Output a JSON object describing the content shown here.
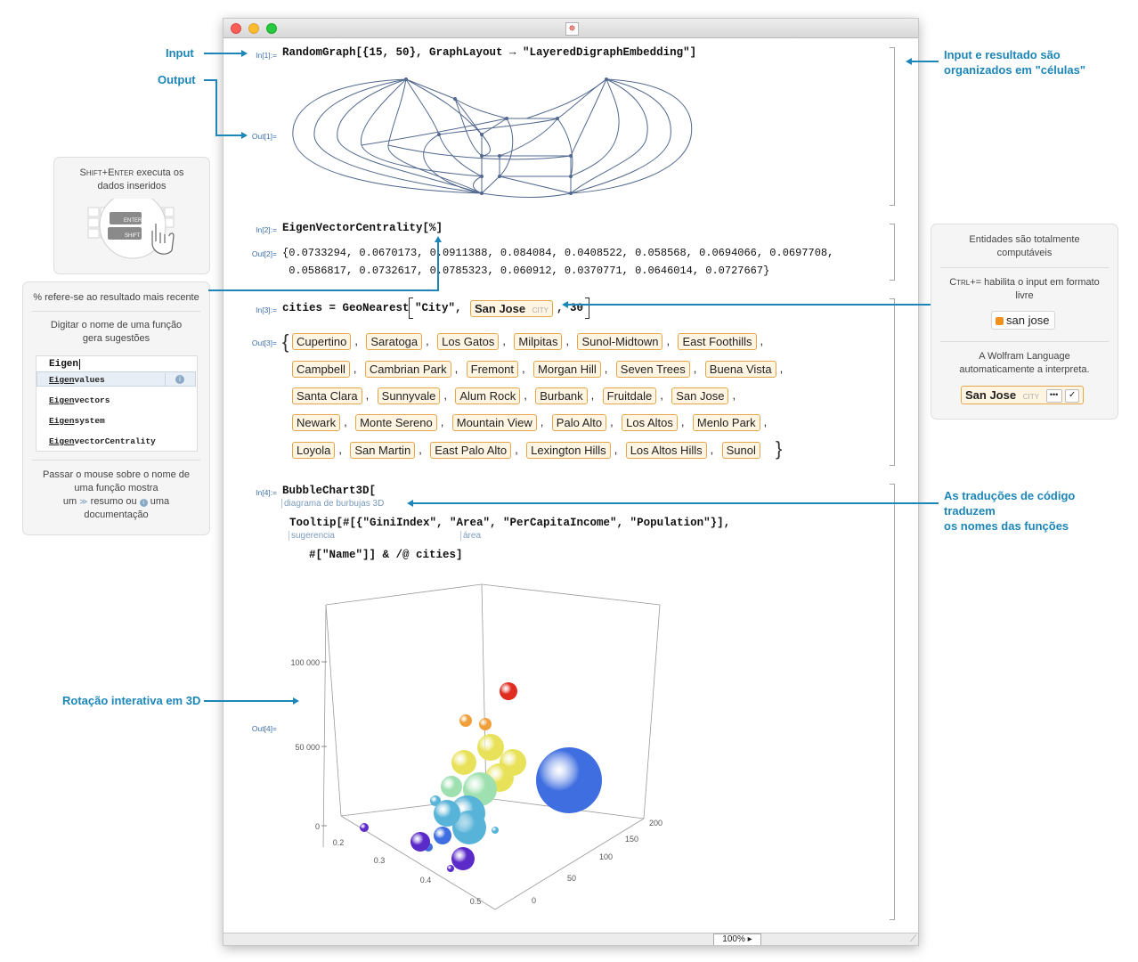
{
  "annotations": {
    "input": "Input",
    "output": "Output",
    "cells_line1": "Input e resultado são",
    "cells_line2": "organizados em \"células\"",
    "translations_line1": "As traduções de código",
    "translations_line2": "traduzem",
    "translations_line3": "os nomes das funções",
    "rotation": "Rotação interativa em 3D"
  },
  "panels": {
    "shift_enter": {
      "text_key": "Shift+Enter",
      "text_rest": " executa os",
      "text_line2": "dados inseridos",
      "key_enter": "ENTER",
      "key_shift": "SHIFT"
    },
    "left": {
      "percent_note": "% refere-se ao resultado mais recente",
      "suggest_line1": "Digitar o nome de uma função",
      "suggest_line2": "gera sugestões",
      "typed": "Eigen",
      "suggestions": [
        "Eigenvalues",
        "Eigenvectors",
        "Eigensystem",
        "EigenvectorCentrality"
      ],
      "hover_line1": "Passar o mouse sobre o nome de",
      "hover_line2": "uma função mostra",
      "hover_line3a": "um",
      "hover_line3b": "resumo ou",
      "hover_line3c": "uma",
      "hover_line4": "documentação"
    },
    "right": {
      "entities_line1": "Entidades são totalmente",
      "entities_line2": "computáveis",
      "ctrl_key": "Ctrl+=",
      "ctrl_rest": " habilita o input em formato",
      "ctrl_line2": "livre",
      "freeform": "san jose",
      "interp_line1": "A Wolfram Language",
      "interp_line2": "automaticamente a interpreta.",
      "entity": "San Jose",
      "entity_type": "CITY"
    }
  },
  "notebook": {
    "zoom": "100%",
    "in1_label": "In[1]:=",
    "in1_code": "RandomGraph[{15, 50}, GraphLayout → \"LayeredDigraphEmbedding\"]",
    "out1_label": "Out[1]=",
    "in2_label": "In[2]:=",
    "in2_code": "EigenVectorCentrality[%]",
    "out2_label": "Out[2]=",
    "out2_line1": "{0.0733294, 0.0670173, 0.0911388, 0.084084, 0.0408522, 0.058568, 0.0694066, 0.0697708,",
    "out2_line2": " 0.0586817, 0.0732617, 0.0785323, 0.060912, 0.0370771, 0.0646014, 0.0727667}",
    "in3_label": "In[3]:=",
    "in3_code_a": "cities = GeoNearest",
    "in3_code_b": "\"City\",",
    "in3_entity": "San Jose",
    "in3_entity_type": "CITY",
    "in3_code_c": ", 30",
    "out3_label": "Out[3]=",
    "cities": [
      [
        "Cupertino",
        "Saratoga",
        "Los Gatos",
        "Milpitas",
        "Sunol-Midtown",
        "East Foothills"
      ],
      [
        "Campbell",
        "Cambrian Park",
        "Fremont",
        "Morgan Hill",
        "Seven Trees",
        "Buena Vista"
      ],
      [
        "Santa Clara",
        "Sunnyvale",
        "Alum Rock",
        "Burbank",
        "Fruitdale",
        "San Jose"
      ],
      [
        "Newark",
        "Monte Sereno",
        "Mountain View",
        "Palo Alto",
        "Los Altos",
        "Menlo Park"
      ],
      [
        "Loyola",
        "San Martin",
        "East Palo Alto",
        "Lexington Hills",
        "Los Altos Hills",
        "Sunol"
      ]
    ],
    "in4_label": "In[4]:=",
    "in4_line1": "BubbleChart3D[",
    "in4_hint1": "diagrama de burbujas 3D",
    "in4_line2": "Tooltip[#[{\"GiniIndex\", \"Area\", \"PerCapitaIncome\", \"Population\"}],",
    "in4_hint2": "sugerencia",
    "in4_hint3": "área",
    "in4_line3": "#[\"Name\"]] & /@ cities]",
    "out4_label": "Out[4]="
  },
  "chart_data": {
    "type": "bubble3d",
    "z_ticks": [
      "100 000",
      "50 000",
      "0"
    ],
    "x_ticks": [
      "0.2",
      "0.3",
      "0.4",
      "0.5"
    ],
    "y_ticks": [
      "0",
      "50",
      "100",
      "150",
      "200"
    ],
    "z_range": [
      0,
      130000
    ],
    "x_range": [
      0.17,
      0.55
    ],
    "y_range": [
      0,
      210
    ],
    "colors": [
      "#5b2bc9",
      "#3f6ee0",
      "#58b3d8",
      "#9fe0b0",
      "#e8e25a",
      "#f0a03a",
      "#e02b1f"
    ]
  }
}
